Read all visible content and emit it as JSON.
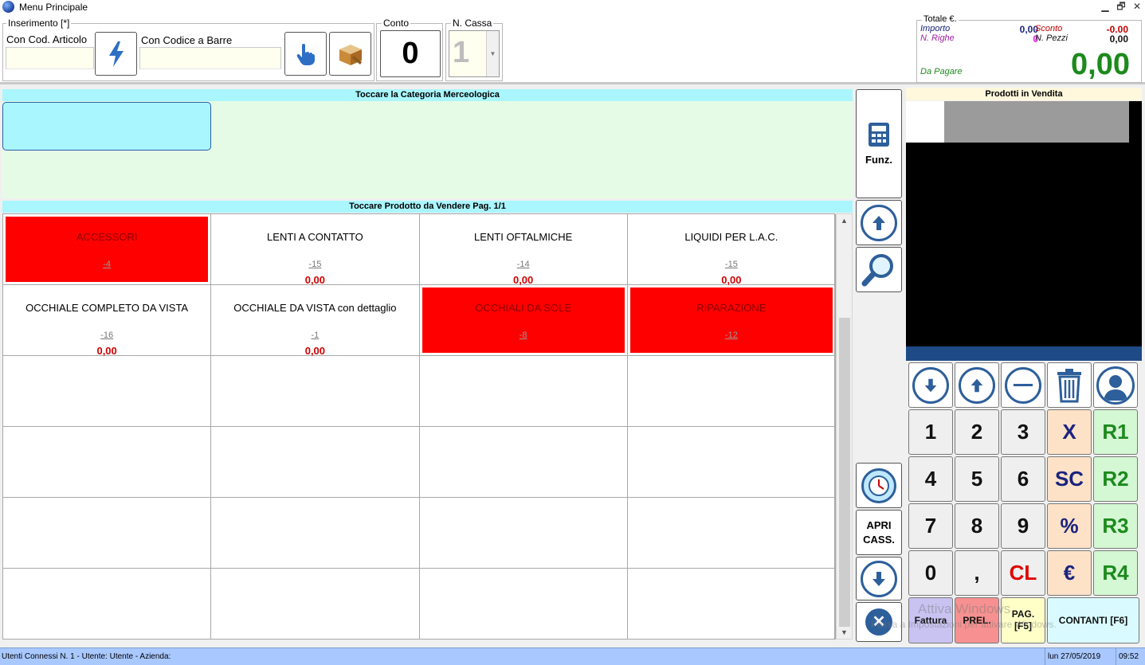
{
  "window": {
    "title": "Menu Principale",
    "min_label": "▁",
    "restore_label": "🗗",
    "close_label": "✕"
  },
  "inserimento": {
    "legend": "Inserimento [*]",
    "cod_articolo_label": "Con Cod. Articolo",
    "cod_articolo_value": "",
    "codice_barre_label": "Con Codice a Barre",
    "codice_barre_value": ""
  },
  "conto": {
    "legend": "Conto",
    "value": "0"
  },
  "cassa": {
    "legend": "N. Cassa",
    "value": "1"
  },
  "totals": {
    "legend": "Totale €.",
    "importo_label": "Importo",
    "importo_value": "0,00",
    "righe_label": "N. Righe",
    "righe_value": "0",
    "sconto_label": "Sconto",
    "sconto_value": "-0.00",
    "pezzi_label": "N. Pezzi",
    "pezzi_value": "0,00",
    "pagare_label": "Da Pagare",
    "pagare_value": "0,00"
  },
  "categories": {
    "header": "Toccare la Categoria Merceologica"
  },
  "products": {
    "header": "Toccare Prodotto da Vendere Pag. 1/1",
    "items": [
      {
        "name": "ACCESSORI",
        "code": "-4",
        "price": "",
        "red": true
      },
      {
        "name": "LENTI A CONTATTO",
        "code": "-15",
        "price": "0,00",
        "red": false
      },
      {
        "name": "LENTI OFTALMICHE",
        "code": "-14",
        "price": "0,00",
        "red": false
      },
      {
        "name": "LIQUIDI PER L.A.C.",
        "code": "-15",
        "price": "0,00",
        "red": false
      },
      {
        "name": "OCCHIALE COMPLETO DA VISTA",
        "code": "-16",
        "price": "0,00",
        "red": false
      },
      {
        "name": "OCCHIALE DA VISTA con dettaglio",
        "code": "-1",
        "price": "0,00",
        "red": false
      },
      {
        "name": "OCCHIALI DA SOLE",
        "code": "-8",
        "price": "",
        "red": true
      },
      {
        "name": "RIPARAZIONE",
        "code": "-12",
        "price": "",
        "red": true
      }
    ]
  },
  "side": {
    "funz_label": "Funz.",
    "apri_label": "APRI",
    "cass_label": "CASS."
  },
  "sale": {
    "header": "Prodotti in Vendita"
  },
  "keypad": {
    "k1": "1",
    "k2": "2",
    "k3": "3",
    "kx": "X",
    "kr1": "R1",
    "k4": "4",
    "k5": "5",
    "k6": "6",
    "ksc": "SC",
    "kr2": "R2",
    "k7": "7",
    "k8": "8",
    "k9": "9",
    "kpct": "%",
    "kr3": "R3",
    "k0": "0",
    "kcomma": ",",
    "kcl": "CL",
    "keur": "€",
    "kr4": "R4",
    "fattura": "Fattura",
    "prel": "PREL.",
    "pag1": "PAG.",
    "pag2": "[F5]",
    "contanti": "CONTANTI [F6]"
  },
  "watermark": {
    "line1": "Attiva Windows",
    "line2": "Passa a Impostazioni per attivare Windows."
  },
  "status": {
    "left": "Utenti Connessi N. 1 - Utente: Utente - Azienda:",
    "date": "lun 27/05/2019",
    "time": "09:52"
  },
  "colors": {
    "accent_blue": "#2d5f9a",
    "cyan_header": "#aaf6ff",
    "red_tile": "#ff0000",
    "green_total": "#1c8a1c"
  }
}
